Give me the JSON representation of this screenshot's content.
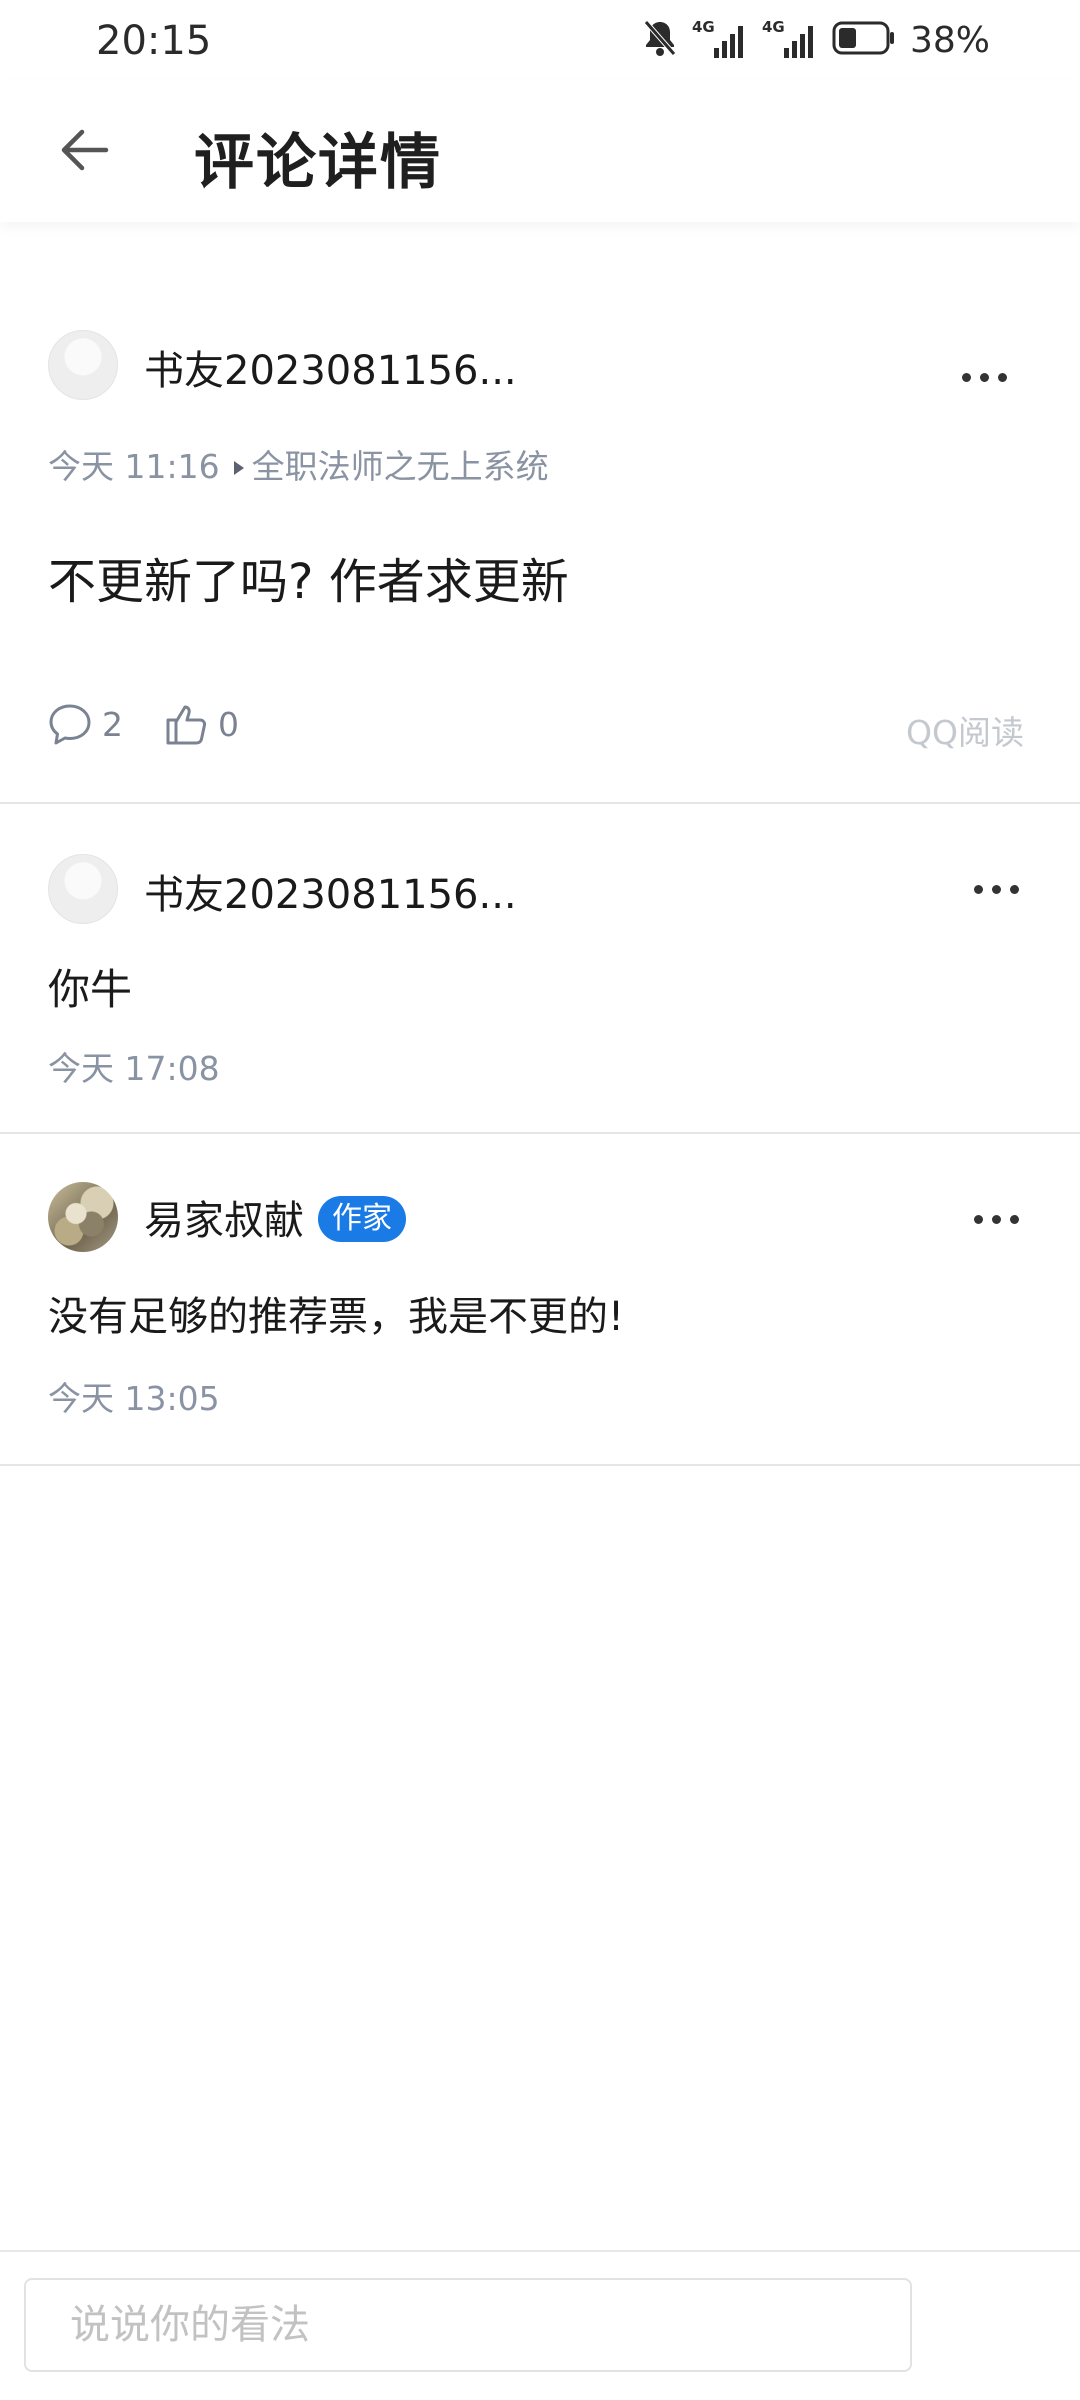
{
  "status_bar": {
    "time": "20:15",
    "battery_percent": "38%",
    "network_label_1": "4G",
    "network_label_2": "4G",
    "battery_level": 0.38
  },
  "header": {
    "title": "评论详情"
  },
  "main_comment": {
    "username": "书友2023081156...",
    "time": "今天 11:16",
    "book": "全职法师之无上系统",
    "text": "不更新了吗? 作者求更新",
    "reply_count": "2",
    "like_count": "0",
    "source": "QQ阅读"
  },
  "replies": [
    {
      "username": "书友2023081156...",
      "text": "你牛",
      "time": "今天 17:08"
    },
    {
      "username": "易家叔献",
      "badge": "作家",
      "text": "没有足够的推荐票，我是不更的!",
      "time": "今天 13:05"
    }
  ],
  "input": {
    "placeholder": "说说你的看法"
  },
  "colors": {
    "badge": "#1a7be6",
    "meta_text": "#8a93a3",
    "source_text": "#c4c8cf"
  }
}
